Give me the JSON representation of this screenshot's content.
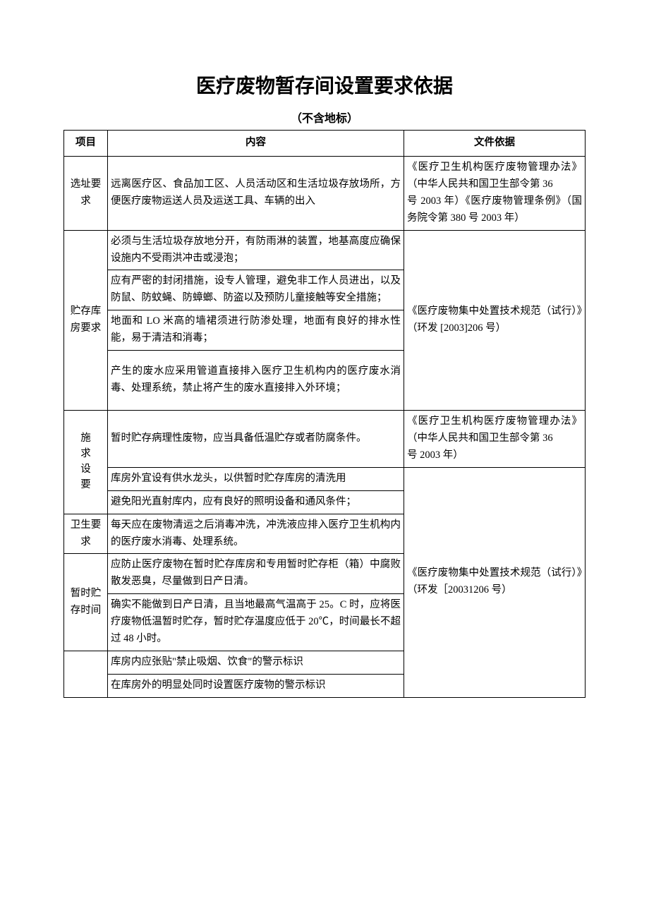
{
  "title": "医疗废物暂存间设置要求依据",
  "subtitle": "（不含地标）",
  "headers": {
    "col1": "项目",
    "col2": "内容",
    "col3": "文件依据"
  },
  "rows": {
    "r1": {
      "label": "选址要求",
      "content": "远离医疗区、食品加工区、人员活动区和生活垃圾存放场所，方便医疗废物运送人员及运送工具、车辆的出入",
      "basis": "《医疗卫生机构医疗废物管理办法》（中华人民共和国卫生部令第 36\n号 2003 年）《医疗废物管理条例》（国务院令第 380 号 2003 年）"
    },
    "r2": {
      "label": "贮存库房要求",
      "c1": "必须与生活垃圾存放地分开，有防雨淋的装置，地基高度应确保设施内不受雨洪冲击或浸泡；",
      "c2": "应有严密的封闭措施，设专人管理，避免非工作人员进出，以及防鼠、防蚊蝇、防蟑螂、防盗以及预防儿童接触等安全措施；",
      "c3": "地面和 LO 米高的墙裙须进行防渗处理，地面有良好的排水性能，易于清洁和消毒；",
      "c4": "产生的废水应采用管道直接排入医疗卫生机构内的医疗废水消毒、处理系统，禁止将产生的废水直接排入外环境；",
      "basis": "《医疗废物集中处置技术规范（试行）》（环发 [2003]206 号）"
    },
    "r3": {
      "label": "施求设要",
      "c1": "暂时贮存病理性废物，应当具备低温贮存或者防腐条件。",
      "c2": "库房外宜设有供水龙头，以供暂时贮存库房的清洗用",
      "c3": "避免阳光直射库内，应有良好的照明设备和通风条件；",
      "basis1": "《医疗卫生机构医疗废物管理办法》（中华人民共和国卫生部令第 36\n号 2003 年）"
    },
    "r4": {
      "label": "卫生要求",
      "content": "每天应在废物清运之后消毒冲洗，冲洗液应排入医疗卫生机构内的医疗废水消毒、处理系统。",
      "basis_shared": "《医疗废物集中处置技术规范（试行）》（环发［20031206 号）"
    },
    "r5": {
      "label": "暂时贮存时间",
      "c1": "应防止医疗废物在暂时贮存库房和专用暂时贮存柜（箱）中腐败散发恶臭，尽量做到日产日清。",
      "c2": "确实不能做到日产日清，且当地最高气温高于 25。C 时，应将医疗废物低温暂时贮存，暂时贮存温度应低于 20℃，时间最长不超过 48 小时。"
    },
    "r6": {
      "c1": "库房内应张贴\"禁止吸烟、饮食\"的警示标识",
      "c2": "在库房外的明显处同时设置医疗废物的警示标识"
    }
  }
}
